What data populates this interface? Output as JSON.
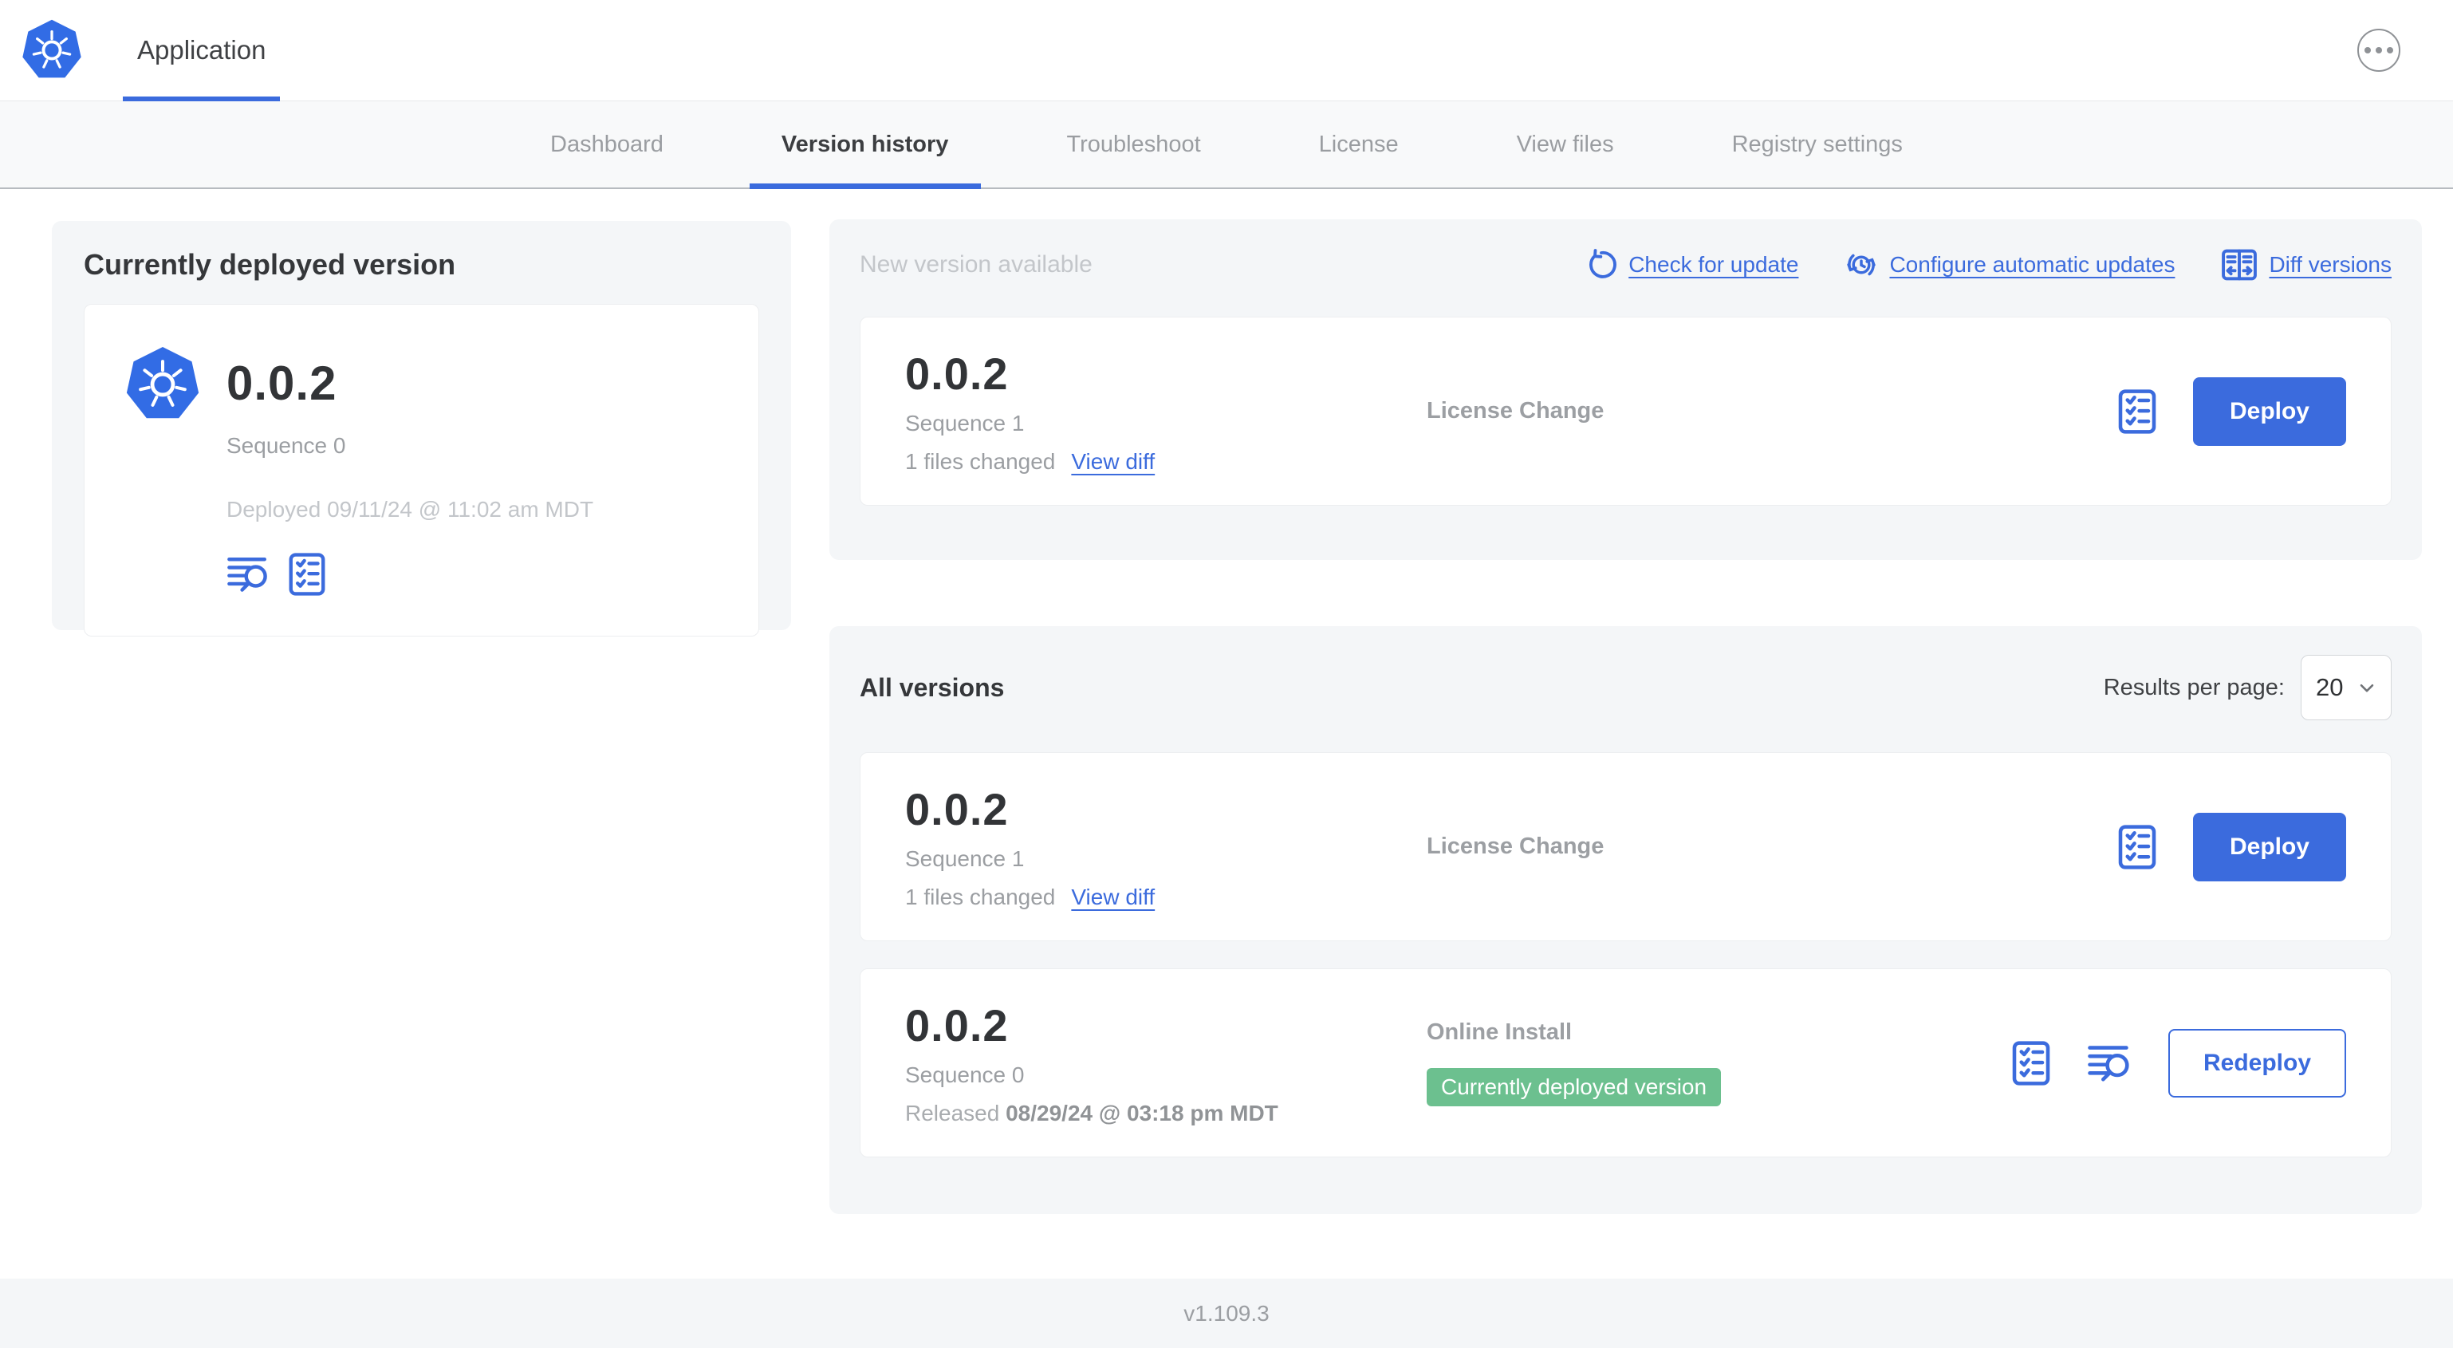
{
  "header": {
    "app_title": "Application"
  },
  "nav": {
    "tabs": [
      {
        "label": "Dashboard",
        "active": false
      },
      {
        "label": "Version history",
        "active": true
      },
      {
        "label": "Troubleshoot",
        "active": false
      },
      {
        "label": "License",
        "active": false
      },
      {
        "label": "View files",
        "active": false
      },
      {
        "label": "Registry settings",
        "active": false
      }
    ]
  },
  "current_version_panel": {
    "title": "Currently deployed version",
    "version": "0.0.2",
    "sequence": "Sequence 0",
    "deployed": "Deployed 09/11/24 @ 11:02 am MDT",
    "icons": [
      "view-logs-icon",
      "preflight-checklist-icon"
    ]
  },
  "new_version_panel": {
    "title": "New version available",
    "links": {
      "check_for_update": "Check for update",
      "configure_automatic_updates": "Configure automatic updates",
      "diff_versions": "Diff versions"
    },
    "card": {
      "version": "0.0.2",
      "sequence": "Sequence 1",
      "files_changed": "1 files changed",
      "view_diff": "View diff",
      "source": "License Change",
      "deploy_label": "Deploy"
    }
  },
  "all_versions_panel": {
    "title": "All versions",
    "results_per_page_label": "Results per page:",
    "results_per_page_value": "20",
    "rows": {
      "0": {
        "version": "0.0.2",
        "sequence": "Sequence 1",
        "files_changed": "1 files changed",
        "view_diff": "View diff",
        "source": "License Change",
        "action_label": "Deploy"
      },
      "1": {
        "version": "0.0.2",
        "sequence": "Sequence 0",
        "released_prefix": "Released",
        "released_date": "08/29/24 @ 03:18 pm MDT",
        "source": "Online Install",
        "badge": "Currently deployed version",
        "action_label": "Redeploy"
      }
    }
  },
  "footer": {
    "version": "v1.109.3"
  },
  "colors": {
    "accent_blue": "#3b6bdd",
    "kubernetes_blue": "#326ce5",
    "badge_green": "#6cc08f",
    "panel_gray": "#f4f6f8"
  }
}
